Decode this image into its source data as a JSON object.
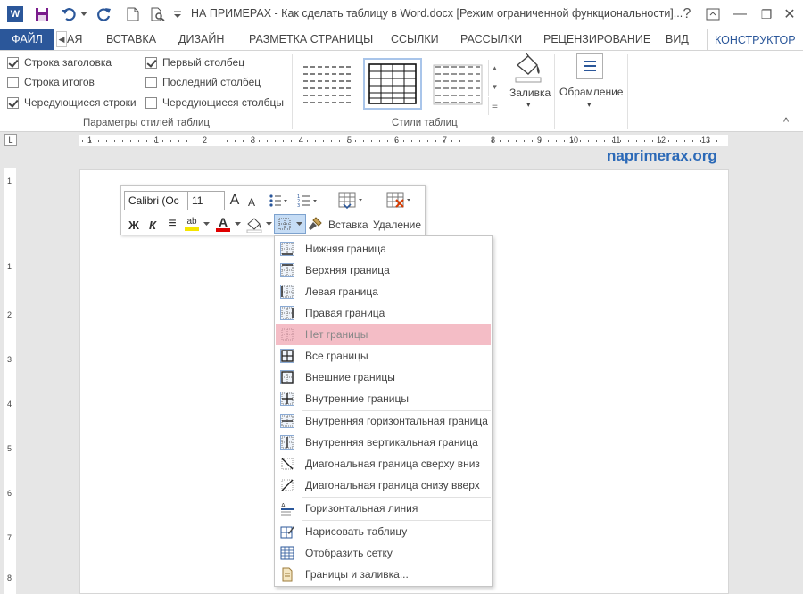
{
  "window": {
    "title": "НА ПРИМЕРАХ - Как сделать таблицу в Word.docx [Режим ограниченной функциональности]...",
    "help": "?",
    "minimize": "—",
    "restore": "❐",
    "close": "✕"
  },
  "qat": {
    "word_icon": "W"
  },
  "tabs": {
    "file": "ФАЙЛ",
    "scroll": "◀",
    "items": [
      "АЯ",
      "ВСТАВКА",
      "ДИЗАЙН",
      "РАЗМЕТКА СТРАНИЦЫ",
      "ССЫЛКИ",
      "РАССЫЛКИ",
      "РЕЦЕНЗИРОВАНИЕ",
      "ВИД"
    ],
    "active": "КОНСТРУКТОР"
  },
  "ribbon": {
    "style_options": {
      "items": [
        {
          "label": "Строка заголовка",
          "checked": true
        },
        {
          "label": "Строка итогов",
          "checked": false
        },
        {
          "label": "Чередующиеся строки",
          "checked": true
        },
        {
          "label": "Первый столбец",
          "checked": true
        },
        {
          "label": "Последний столбец",
          "checked": false
        },
        {
          "label": "Чередующиеся столбцы",
          "checked": false
        }
      ],
      "label": "Параметры стилей таблиц"
    },
    "table_styles": {
      "label": "Стили таблиц"
    },
    "shading": {
      "label": "Заливка",
      "arrow": "▾"
    },
    "borders": {
      "label": "Обрамление",
      "arrow": "▾"
    },
    "collapse": "^"
  },
  "ruler": {
    "corner": "L",
    "h_numbers": [
      "1",
      "1",
      "2",
      "3",
      "4",
      "5",
      "6",
      "7",
      "8",
      "9",
      "10",
      "11",
      "12",
      "13"
    ],
    "v_numbers": [
      "1",
      "1",
      "2",
      "3",
      "4",
      "5",
      "6",
      "7",
      "8"
    ]
  },
  "watermark": "naprimerax.org",
  "mini_toolbar": {
    "font_name": "Calibri (Oc",
    "font_size": "11",
    "grow_font": "A",
    "shrink_font": "A",
    "bold": "Ж",
    "italic": "К",
    "align": "≡",
    "highlight": "ab",
    "font_color": "A",
    "insert_label": "Вставка",
    "delete_label": "Удаление",
    "colors": {
      "highlight": "#f5e500",
      "font": "#e00000"
    }
  },
  "border_menu": {
    "items": [
      {
        "label": "Нижняя граница",
        "icon": "border-bottom-icon"
      },
      {
        "label": "Верхняя граница",
        "icon": "border-top-icon"
      },
      {
        "label": "Левая граница",
        "icon": "border-left-icon"
      },
      {
        "label": "Правая граница",
        "icon": "border-right-icon"
      },
      {
        "label": "Нет границы",
        "icon": "no-border-icon",
        "hot": true
      },
      {
        "label": "Все границы",
        "icon": "all-borders-icon"
      },
      {
        "label": "Внешние границы",
        "icon": "outside-borders-icon"
      },
      {
        "label": "Внутренние границы",
        "icon": "inside-borders-icon"
      },
      {
        "label": "Внутренняя горизонтальная граница",
        "icon": "inside-horizontal-border-icon"
      },
      {
        "label": "Внутренняя вертикальная граница",
        "icon": "inside-vertical-border-icon"
      },
      {
        "label": "Диагональная граница сверху вниз",
        "icon": "diagonal-down-border-icon"
      },
      {
        "label": "Диагональная граница снизу вверх",
        "icon": "diagonal-up-border-icon"
      },
      {
        "label": "Горизонтальная линия",
        "icon": "horizontal-line-icon"
      },
      {
        "label": "Нарисовать таблицу",
        "icon": "draw-table-icon"
      },
      {
        "label": "Отобразить сетку",
        "icon": "view-gridlines-icon"
      },
      {
        "label": "Границы и заливка...",
        "icon": "borders-shading-icon"
      }
    ]
  }
}
